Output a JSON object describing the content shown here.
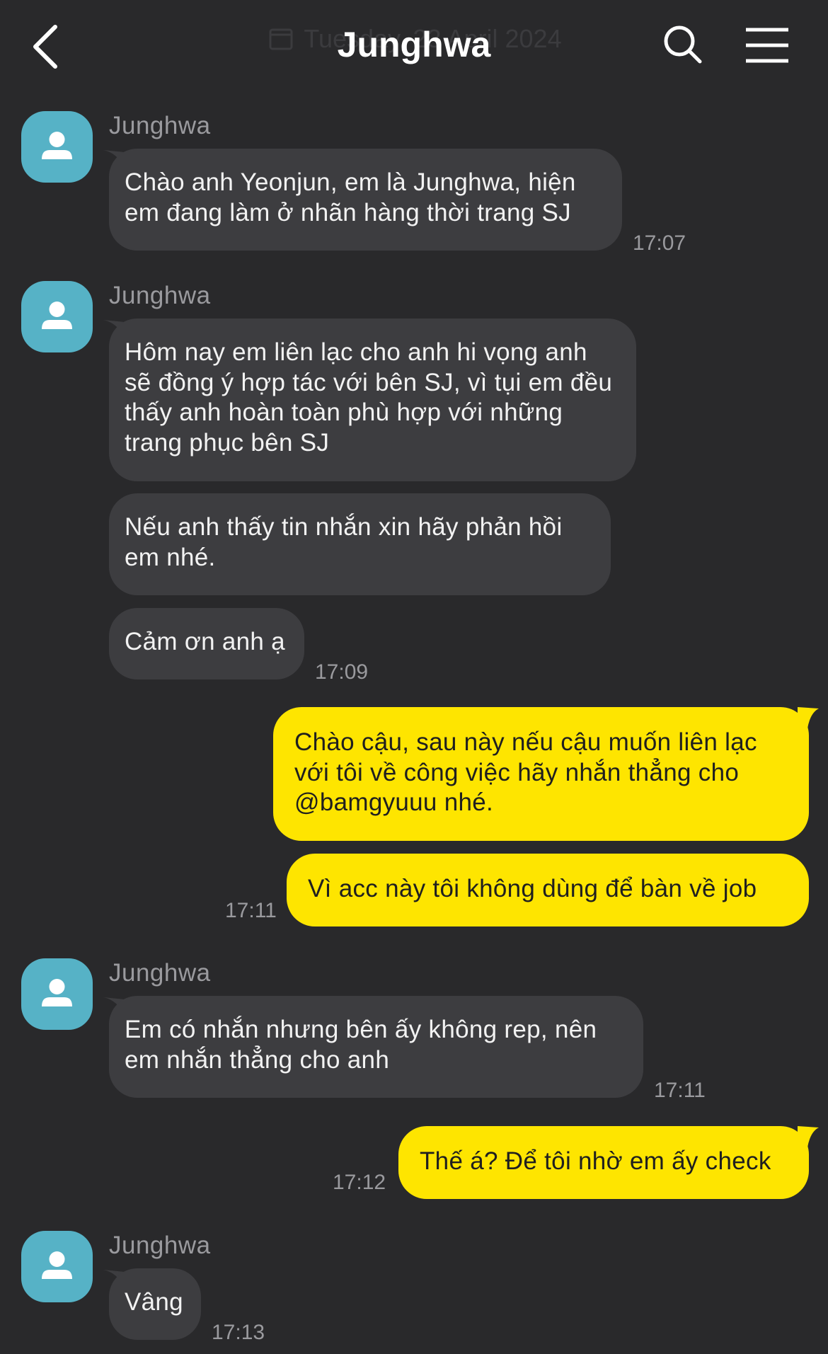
{
  "header": {
    "title": "Junghwa",
    "date_overlay": "Tuesday, 23 April 2024"
  },
  "messages": [
    {
      "side": "in",
      "sender": "Junghwa",
      "text": "Chào anh Yeonjun, em là Junghwa, hiện em đang làm ở nhãn hàng thời trang SJ",
      "time": "17:07"
    },
    {
      "side": "in",
      "sender": "Junghwa",
      "text": "Hôm nay em liên lạc cho anh hi vọng anh sẽ đồng ý hợp tác với bên SJ, vì tụi em đều thấy anh hoàn toàn phù hợp với những trang phục bên SJ"
    },
    {
      "side": "in",
      "text": "Nếu anh thấy tin nhắn xin hãy phản hồi em nhé."
    },
    {
      "side": "in",
      "text": "Cảm ơn anh ạ",
      "time": "17:09"
    },
    {
      "side": "out",
      "text": "Chào cậu, sau này nếu cậu muốn liên lạc với tôi về công việc hãy nhắn thẳng cho @bamgyuuu nhé."
    },
    {
      "side": "out",
      "text": "Vì acc này tôi không dùng để bàn về job",
      "time": "17:11"
    },
    {
      "side": "in",
      "sender": "Junghwa",
      "text": "Em có nhắn nhưng bên ấy không rep, nên em nhắn thẳng cho anh",
      "time": "17:11"
    },
    {
      "side": "out",
      "text": "Thế á? Để tôi nhờ em ấy check",
      "time": "17:12"
    },
    {
      "side": "in",
      "sender": "Junghwa",
      "text": "Vâng",
      "time": "17:13"
    }
  ],
  "icons": {
    "back": "chevron-left-icon",
    "search": "search-icon",
    "menu": "hamburger-menu-icon",
    "avatar": "person-icon",
    "date": "calendar-icon"
  },
  "colors": {
    "background": "#29292b",
    "incoming_bubble": "#3d3d40",
    "outgoing_bubble": "#fee500",
    "avatar": "#56b2c6",
    "timestamp": "#9a9a9e"
  }
}
